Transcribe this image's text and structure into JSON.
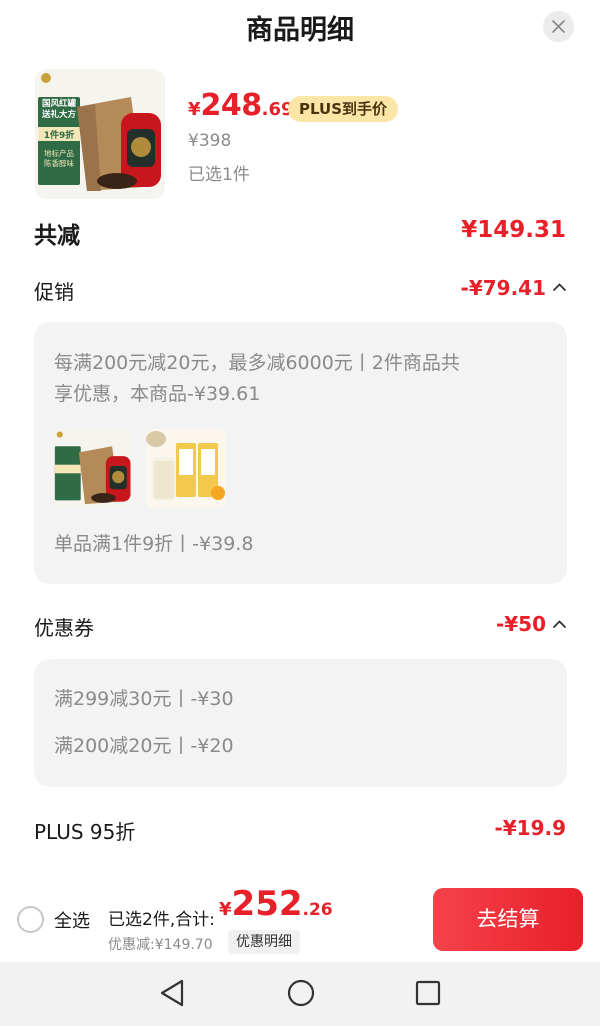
{
  "header": {
    "title": "商品明细"
  },
  "product": {
    "price_yen": "¥",
    "price_int": "248",
    "price_dec": ".69",
    "plus_badge": "PLUS到手价",
    "original_price": "¥398",
    "selected": "已选1件",
    "thumb_text": {
      "line1": "国风红罐",
      "line2": "送礼大方",
      "line3": "1件9折",
      "line4": "地标产品",
      "line5": "陈香醇味"
    }
  },
  "summary": {
    "total_label": "共减",
    "total_value": "¥149.31",
    "promo": {
      "label": "促销",
      "value": "-¥79.41",
      "line1": "每满200元减20元，最多减6000元丨2件商品共",
      "line2": "享优惠，本商品-¥39.61",
      "single": "单品满1件9折丨-¥39.8"
    },
    "coupon": {
      "label": "优惠券",
      "value": "-¥50",
      "items": [
        "满299减30元丨-¥30",
        "满200减20元丨-¥20"
      ]
    },
    "plus": {
      "label": "PLUS 95折",
      "value": "-¥19.9"
    }
  },
  "footer": {
    "select_all": "全选",
    "sum_label": "已选2件,合计:",
    "sum_yen": "¥",
    "sum_int": "252",
    "sum_dec": ".26",
    "discount": "优惠减:¥149.70",
    "detail_button": "优惠明细",
    "checkout_button": "去结算"
  },
  "colors": {
    "accent": "#e8202a",
    "badge": "#fbe6a8",
    "panel": "#f3f3f3"
  }
}
